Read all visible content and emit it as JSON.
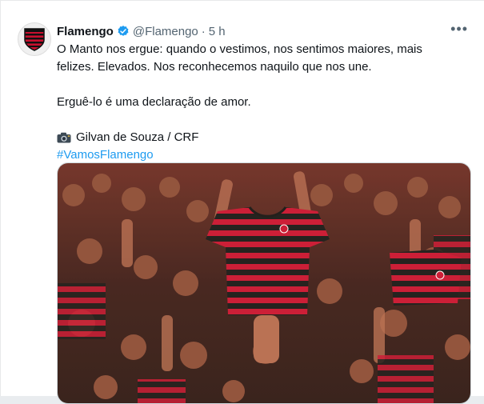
{
  "tweet": {
    "author_name": "Flamengo",
    "handle": "@Flamengo",
    "separator": "·",
    "time": "5 h",
    "lines": [
      "O Manto nos ergue: quando o vestimos, nos sentimos maiores, mais",
      "felizes. Elevados. Nos reconhecemos naquilo que nos une."
    ],
    "declaration": "Erguê-lo é uma declaração de amor.",
    "photo_credit": "Gilvan de Souza / CRF",
    "hashtag": "#VamosFlamengo"
  },
  "icons": {
    "avatar": "flamengo-crest-icon",
    "verified": "verified-badge-icon",
    "more": "more-options-icon",
    "camera": "camera-icon"
  },
  "colors": {
    "accent": "#1d9bf0",
    "text": "#0f1419",
    "secondary": "#536471",
    "club_red": "#c8102e",
    "club_black": "#111111"
  }
}
